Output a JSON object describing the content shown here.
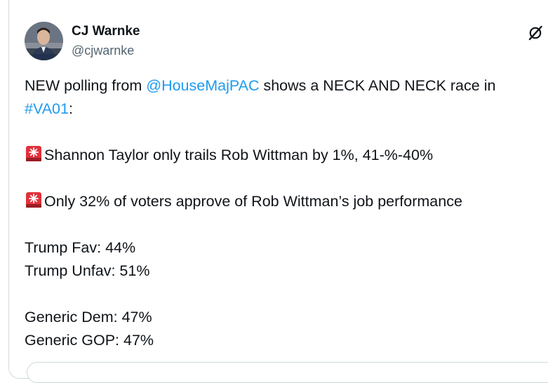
{
  "author": {
    "name": "CJ Warnke",
    "handle": "@cjwarnke"
  },
  "icons": {
    "avatar": "profile-photo",
    "brand": "x-logo-icon",
    "emoji": "police-light-siren"
  },
  "tweet": {
    "line1_prefix": "NEW polling from ",
    "line1_mention": "@HouseMajPAC",
    "line1_suffix": " shows a NECK AND NECK race in",
    "line2_hashtag": "#VA01",
    "line2_suffix": ":",
    "siren_line1": "Shannon Taylor only trails Rob Wittman by 1%, 41-%-40%",
    "siren_line2": "Only 32% of voters approve of Rob Wittman’s job performance",
    "trump_fav": "Trump Fav: 44%",
    "trump_unfav": "Trump Unfav: 51%",
    "generic_dem": "Generic Dem: 47%",
    "generic_gop": "Generic GOP: 47%"
  },
  "colors": {
    "link": "#1d9bf0",
    "text": "#0f1419",
    "secondary": "#536471",
    "border": "#cfd9de",
    "siren": "#e0313b"
  }
}
